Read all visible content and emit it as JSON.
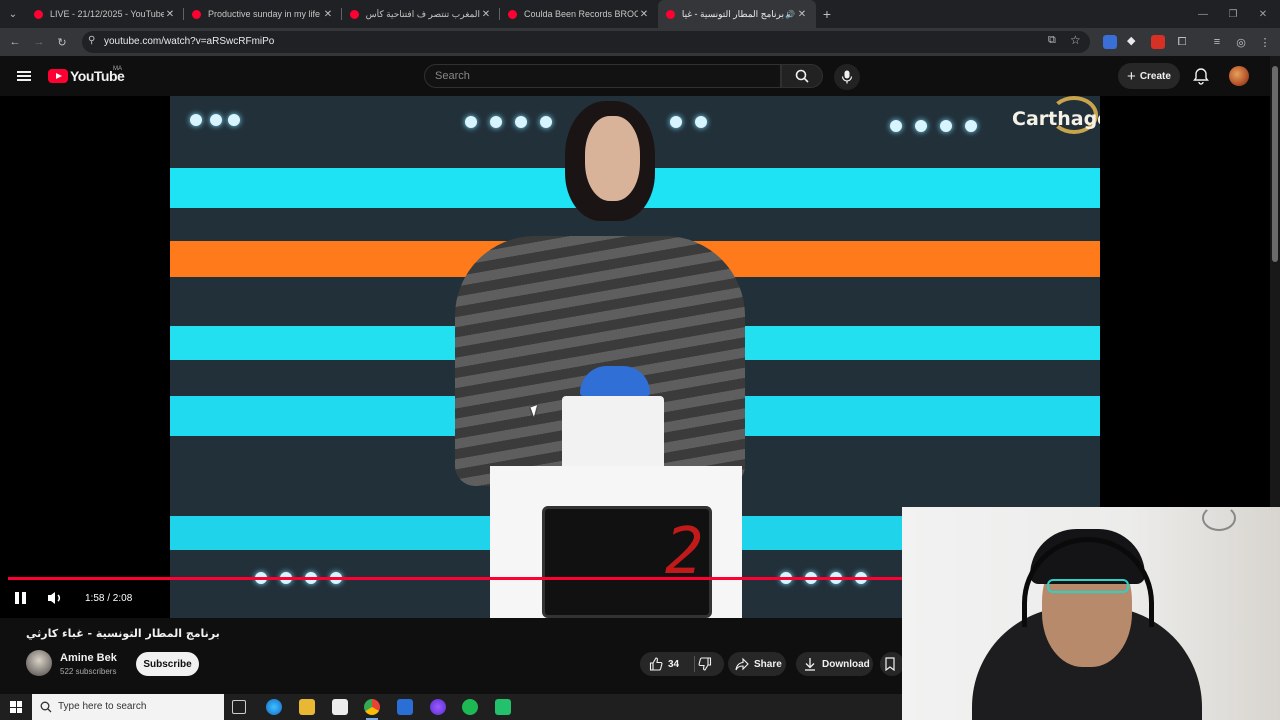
{
  "browser": {
    "tabs": [
      {
        "title": "LIVE - 21/12/2025 - YouTube",
        "active": false
      },
      {
        "title": "Productive sunday in my life ||w",
        "active": false
      },
      {
        "title": "المغرب تنتصر ف افتتاحية كأس الأ",
        "active": false
      },
      {
        "title": "Coulda Been Records BROOKLY",
        "active": false
      },
      {
        "title": "برنامج المطار التونسية - غياء",
        "active": true
      }
    ],
    "url": "youtube.com/watch?v=aRSwcRFmiPo"
  },
  "youtube": {
    "logo_text": "YouTube",
    "country_code": "MA",
    "search_placeholder": "Search",
    "create_label": "Create"
  },
  "player": {
    "overlay_text": "Carthage",
    "scoreboard_digit": "2",
    "timecode": "1:58 / 2:08",
    "progress": 0.93
  },
  "video": {
    "title": "برنامج المطار التونسية - غباء كارثي",
    "channel_name": "Amine Bek",
    "subscribers": "522 subscribers",
    "subscribe_label": "Subscribe",
    "likes": "34",
    "share_label": "Share",
    "download_label": "Download"
  },
  "taskbar": {
    "search_placeholder": "Type here to search"
  },
  "colors": {
    "youtube_red": "#ff0033",
    "stage_cyan": "#19e0f2",
    "stage_orange": "#ff7a1a"
  }
}
